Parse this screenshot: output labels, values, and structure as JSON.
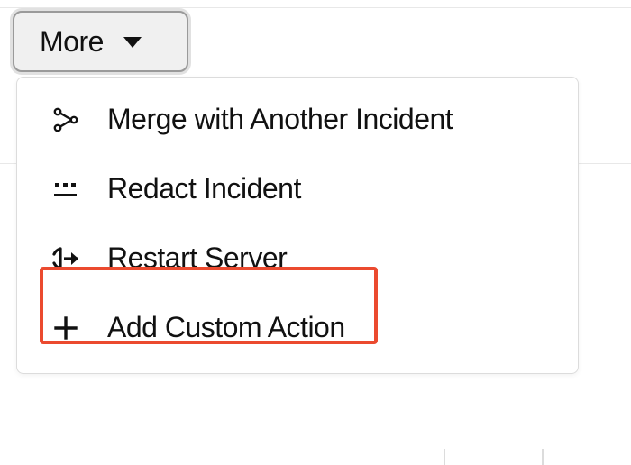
{
  "more_button": {
    "label": "More"
  },
  "menu": {
    "items": [
      {
        "label": "Merge with Another Incident",
        "icon": "merge-icon"
      },
      {
        "label": "Redact Incident",
        "icon": "redact-icon"
      },
      {
        "label": "Restart Server",
        "icon": "restart-icon",
        "highlighted": true
      },
      {
        "label": "Add Custom Action",
        "icon": "plus-icon"
      }
    ]
  }
}
